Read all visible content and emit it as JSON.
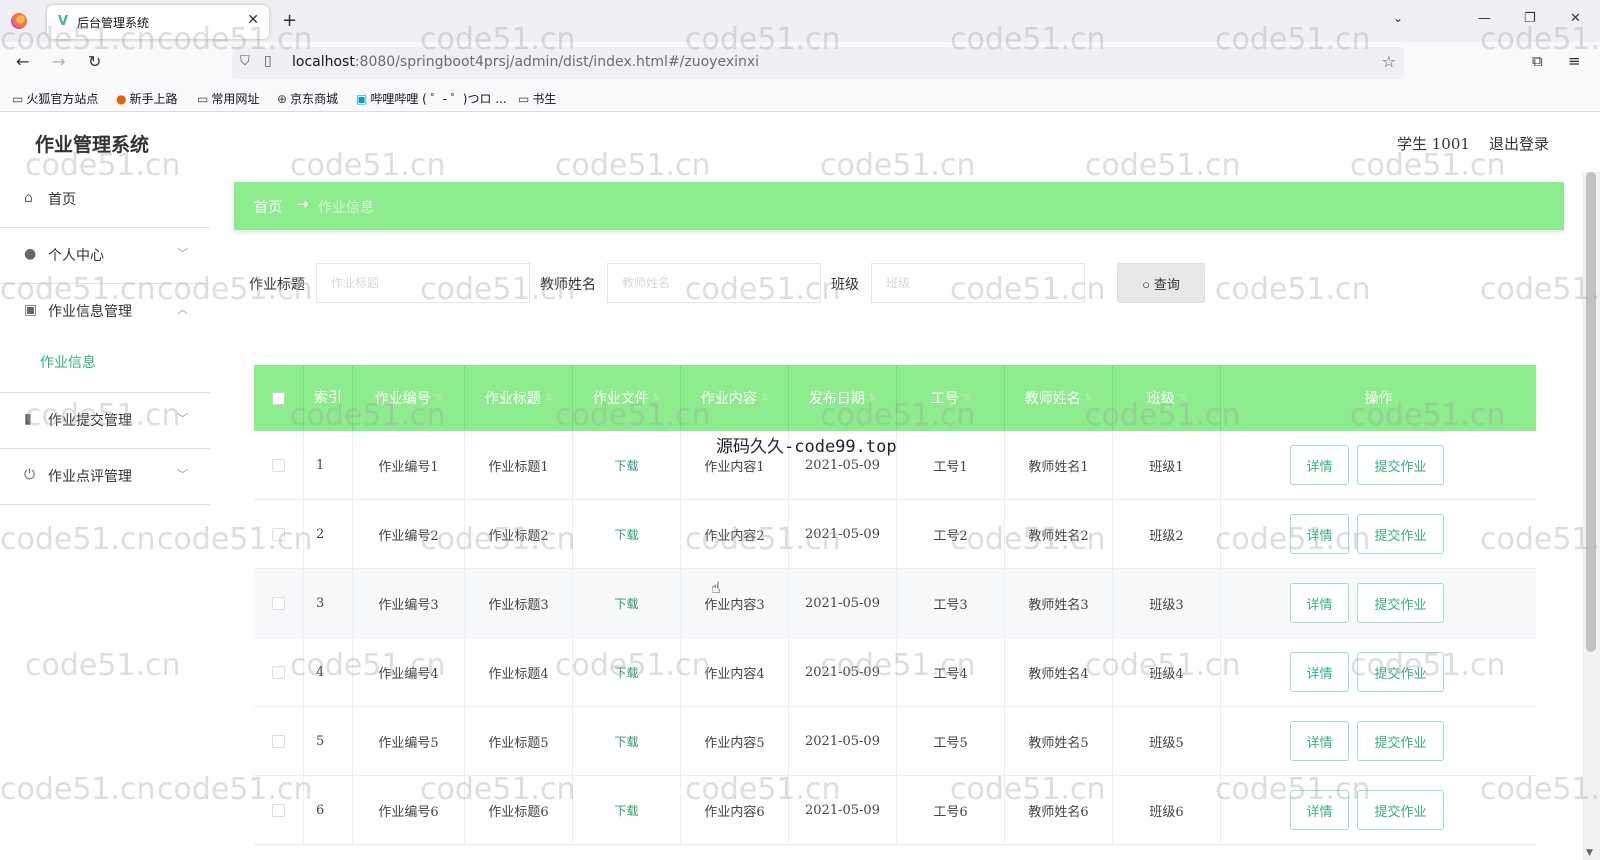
{
  "browser": {
    "tab_title": "后台管理系统",
    "url_host": "localhost",
    "url_rest": ":8080/springboot4prsj/admin/dist/index.html#/zuoyexinxi",
    "bookmarks": [
      "火狐官方站点",
      "新手上路",
      "常用网址",
      "京东商城",
      "哔哩哔哩 ( ゜- ゜)つロ ...",
      "书生"
    ]
  },
  "header": {
    "title": "作业管理系统",
    "user": "学生 1001",
    "logout": "退出登录"
  },
  "sidebar": {
    "items": [
      {
        "label": "首页",
        "icon": "home-icon"
      },
      {
        "label": "个人中心",
        "icon": "user-icon"
      },
      {
        "label": "作业信息管理",
        "icon": "clipboard-icon"
      },
      {
        "label": "作业提交管理",
        "icon": "bar-chart-icon"
      },
      {
        "label": "作业点评管理",
        "icon": "power-icon"
      }
    ],
    "active_sub": "作业信息"
  },
  "breadcrumb": {
    "home": "首页",
    "separator": "→",
    "current": "作业信息"
  },
  "search": {
    "title_label": "作业标题",
    "title_placeholder": "作业标题",
    "teacher_label": "教师姓名",
    "teacher_placeholder": "教师姓名",
    "class_label": "班级",
    "class_placeholder": "班级",
    "button": "查询"
  },
  "table": {
    "headers": [
      "索引",
      "作业编号",
      "作业标题",
      "作业文件",
      "作业内容",
      "发布日期",
      "工号",
      "教师姓名",
      "班级",
      "操作"
    ],
    "rows": [
      {
        "index": "1",
        "code": "作业编号1",
        "title": "作业标题1",
        "file": "下载",
        "content": "作业内容1",
        "date": "2021-05-09",
        "staff": "工号1",
        "teacher": "教师姓名1",
        "cls": "班级1"
      },
      {
        "index": "2",
        "code": "作业编号2",
        "title": "作业标题2",
        "file": "下载",
        "content": "作业内容2",
        "date": "2021-05-09",
        "staff": "工号2",
        "teacher": "教师姓名2",
        "cls": "班级2"
      },
      {
        "index": "3",
        "code": "作业编号3",
        "title": "作业标题3",
        "file": "下载",
        "content": "作业内容3",
        "date": "2021-05-09",
        "staff": "工号3",
        "teacher": "教师姓名3",
        "cls": "班级3"
      },
      {
        "index": "4",
        "code": "作业编号4",
        "title": "作业标题4",
        "file": "下载",
        "content": "作业内容4",
        "date": "2021-05-09",
        "staff": "工号4",
        "teacher": "教师姓名4",
        "cls": "班级4"
      },
      {
        "index": "5",
        "code": "作业编号5",
        "title": "作业标题5",
        "file": "下载",
        "content": "作业内容5",
        "date": "2021-05-09",
        "staff": "工号5",
        "teacher": "教师姓名5",
        "cls": "班级5"
      },
      {
        "index": "6",
        "code": "作业编号6",
        "title": "作业标题6",
        "file": "下载",
        "content": "作业内容6",
        "date": "2021-05-09",
        "staff": "工号6",
        "teacher": "教师姓名6",
        "cls": "班级6"
      }
    ],
    "detail_btn": "详情",
    "submit_btn": "提交作业"
  },
  "watermark": "code51.cn",
  "center_watermark": "源码久久-code99.top",
  "colors": {
    "accent_green": "#8ded8d",
    "link_green": "#35b27a"
  }
}
